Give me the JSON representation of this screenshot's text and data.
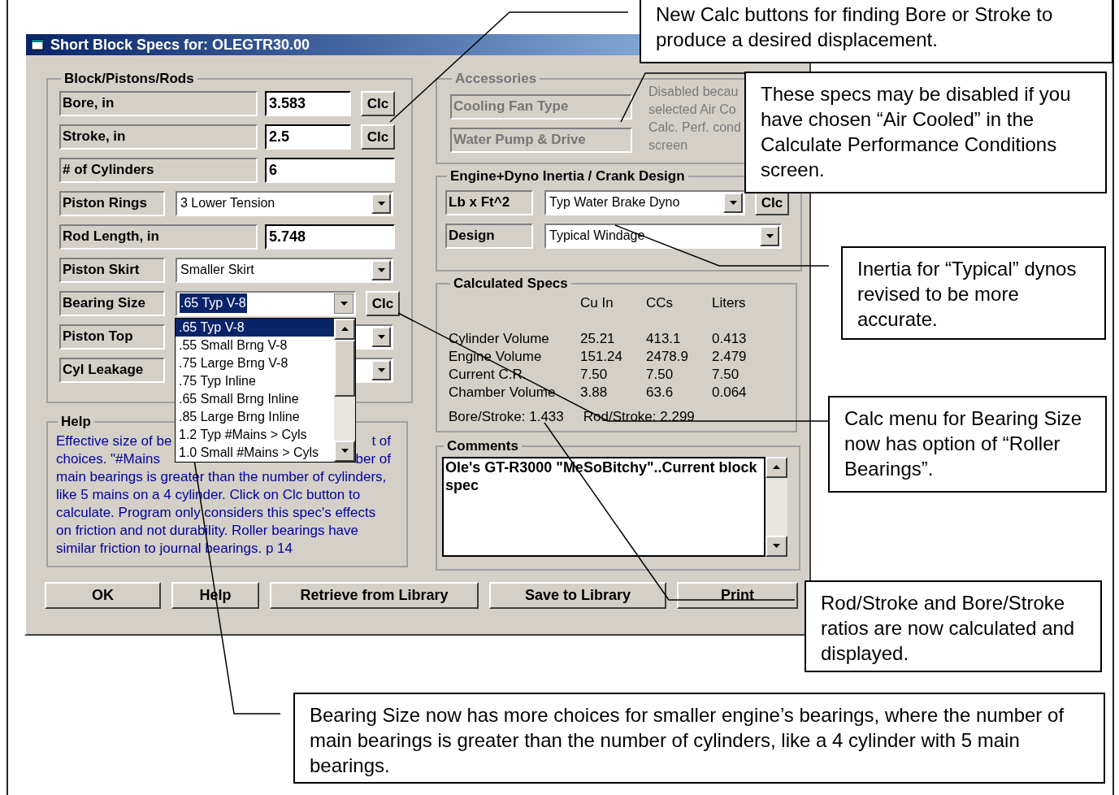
{
  "window": {
    "title": "Short Block Specs for: OLEGTR30.00"
  },
  "block_group": {
    "title": "Block/Pistons/Rods",
    "rows": [
      {
        "kind": "text",
        "label": "Bore, in",
        "value": "3.583",
        "button": "Clc"
      },
      {
        "kind": "text",
        "label": "Stroke, in",
        "value": "2.5",
        "button": "Clc"
      },
      {
        "kind": "text",
        "label": "# of Cylinders",
        "value": "6"
      },
      {
        "kind": "combo",
        "label": "Piston Rings",
        "value": "3 Lower Tension"
      },
      {
        "kind": "text",
        "label": "Rod Length, in",
        "value": "5.748"
      },
      {
        "kind": "combo",
        "label": "Piston Skirt",
        "value": "Smaller Skirt"
      },
      {
        "kind": "combo",
        "label": "Bearing Size",
        "value": ".65 Typ V-8",
        "button": "Clc",
        "focused": true,
        "open": true
      },
      {
        "kind": "combo",
        "label": "Piston Top"
      },
      {
        "kind": "combo",
        "label": "Cyl Leakage"
      }
    ]
  },
  "dropdown": {
    "items": [
      {
        "label": ".65 Typ V-8",
        "selected": true
      },
      {
        "label": ".55 Small Brng V-8",
        "selected": false
      },
      {
        "label": ".75 Large Brng V-8",
        "selected": false
      },
      {
        "label": ".75 Typ Inline",
        "selected": false
      },
      {
        "label": ".65 Small Brng Inline",
        "selected": false
      },
      {
        "label": ".85 Large Brng Inline",
        "selected": false
      },
      {
        "label": "1.2 Typ #Mains > Cyls",
        "selected": false
      },
      {
        "label": "1.0 Small #Mains > Cyls",
        "selected": false
      }
    ]
  },
  "help": {
    "title": "Help",
    "lines": [
      {
        "left": "Effective size of be",
        "right": "t of"
      },
      {
        "left": "choices.  \"#Mains",
        "right": "ber of"
      },
      {
        "left": "main bearings is greater than the number of cylinders,"
      },
      {
        "left": "like 5 mains on a 4 cylinder.  Click on Clc button to"
      },
      {
        "left": "calculate.  Program only considers this spec's effects"
      },
      {
        "left": "on friction and not durability.  Roller bearings have"
      },
      {
        "left": "similar friction to journal bearings.  p 14"
      }
    ]
  },
  "accessories": {
    "title": "Accessories",
    "disabled": true,
    "items": [
      "Cooling Fan Type",
      "Water Pump & Drive"
    ],
    "note_lines": [
      "Disabled becau",
      "selected Air Co",
      "Calc. Perf. cond",
      "screen"
    ]
  },
  "inertia": {
    "title": "Engine+Dyno Inertia / Crank Design",
    "rows": [
      {
        "label": "Lb x Ft^2",
        "value": "Typ Water Brake Dyno",
        "button": "Clc"
      },
      {
        "label": "Design",
        "value": "Typical Windage"
      }
    ]
  },
  "calculated": {
    "title": "Calculated Specs",
    "columns": [
      "Cu In",
      "CCs",
      "Liters"
    ],
    "rows": [
      {
        "label": "Cylinder Volume",
        "values": [
          "25.21",
          "413.1",
          "0.413"
        ]
      },
      {
        "label": "Engine Volume",
        "values": [
          "151.24",
          "2478.9",
          "2.479"
        ]
      },
      {
        "label": "Current C.R.",
        "values": [
          "7.50",
          "7.50",
          "7.50"
        ]
      },
      {
        "label": "Chamber Volume",
        "values": [
          "3.88",
          "63.6",
          "0.064"
        ]
      }
    ],
    "ratios": [
      "Bore/Stroke: 1.433",
      "Rod/Stroke: 2.299"
    ]
  },
  "comments": {
    "title": "Comments",
    "value": "Ole's GT-R3000 \"MeSoBitchy\"..Current block spec"
  },
  "buttons": [
    "OK",
    "Help",
    "Retrieve from Library",
    "Save to Library",
    "Print"
  ],
  "callouts": [
    "New Calc buttons for finding Bore or Stroke to produce a desired displacement.",
    "These specs may be disabled if you have chosen “Air Cooled” in the Calculate Performance Conditions screen.",
    "Inertia for “Typical” dynos revised to be more accurate.",
    "Calc menu for Bearing Size now has option of “Roller Bearings”.",
    "Rod/Stroke and Bore/Stroke ratios are now calculated and displayed.",
    "Bearing Size now has more choices for smaller engine’s bearings, where the number of main bearings is greater than the number of cylinders, like a 4 cylinder with 5 main bearings."
  ]
}
